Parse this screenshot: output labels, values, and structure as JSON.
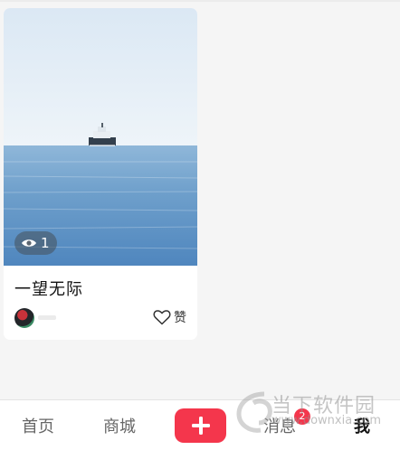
{
  "post": {
    "title": "一望无际",
    "views": "1",
    "like_label": "赞"
  },
  "tabs": {
    "home": "首页",
    "shop": "商城",
    "messages": "消息",
    "messages_badge": "2",
    "me": "我"
  },
  "watermark": {
    "name": "当下软件园",
    "url": "www.downxia.com"
  },
  "colors": {
    "accent": "#f4364c",
    "background": "#f5f5f5"
  },
  "icons": {
    "views": "eye-icon",
    "like": "heart-outline-icon",
    "post": "plus-icon",
    "avatar": "user-avatar"
  }
}
